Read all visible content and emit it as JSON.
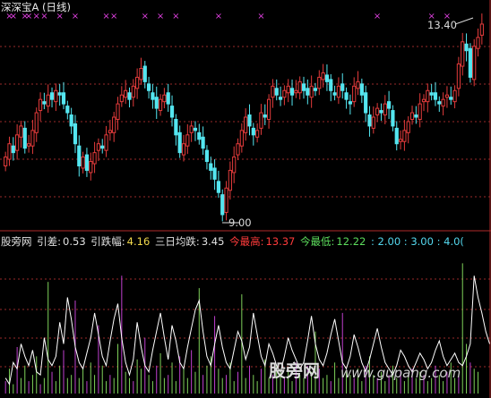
{
  "title": "深深宝A (日线)",
  "colors": {
    "up": "#e33b3b",
    "down": "#54e6f0",
    "grid": "#9a2a2a",
    "signal": "#e040e0",
    "vol_green": "#7fd15a",
    "vol_magenta": "#c040d0",
    "line_white": "#ffffff"
  },
  "indicator": {
    "name": "股旁网",
    "yincha_label": "引差:",
    "yincha_value": "0.53",
    "yindiefu_label": "引跌幅:",
    "yindiefu_value": "4.16",
    "sanri_label": "三日均跌:",
    "sanri_value": "3.45",
    "zuigao_label": "今最高:",
    "zuigao_value": "13.37",
    "zuidi_label": "今最低:",
    "zuidi_value": "12.22",
    "levels_text": ": 2.00 : 3.00 : 4.0("
  },
  "annotations": {
    "high_label": "13.40",
    "low_label": "9.00"
  },
  "watermark": {
    "cn": "股旁网",
    "url": "www.gupang.com"
  },
  "chart_data": {
    "type": "candlestick",
    "price_high": 13.4,
    "price_low": 9.0,
    "closes": [
      10.3,
      10.6,
      10.4,
      10.8,
      11.0,
      10.5,
      10.6,
      10.9,
      11.3,
      11.6,
      11.5,
      11.7,
      11.6,
      11.8,
      11.7,
      11.5,
      11.3,
      11.0,
      10.6,
      10.1,
      10.3,
      10.0,
      10.2,
      10.4,
      10.6,
      10.5,
      10.8,
      10.9,
      11.2,
      11.5,
      11.7,
      11.8,
      11.6,
      11.9,
      12.1,
      12.3,
      12.0,
      11.8,
      11.6,
      11.4,
      11.6,
      11.7,
      11.5,
      11.2,
      10.8,
      10.4,
      10.6,
      10.8,
      11.0,
      10.9,
      10.7,
      10.5,
      10.2,
      10.0,
      9.8,
      9.5,
      9.0,
      9.6,
      10.0,
      10.3,
      10.6,
      10.9,
      11.2,
      11.0,
      10.8,
      10.9,
      11.3,
      11.2,
      11.6,
      11.9,
      11.7,
      11.6,
      11.8,
      11.9,
      11.7,
      11.8,
      12.0,
      11.8,
      11.7,
      11.9,
      11.8,
      12.1,
      12.2,
      12.0,
      11.8,
      11.7,
      11.9,
      11.8,
      11.6,
      11.5,
      11.9,
      12.0,
      11.7,
      11.3,
      11.0,
      11.2,
      11.4,
      11.3,
      11.5,
      11.4,
      11.0,
      10.6,
      10.7,
      10.9,
      11.1,
      11.3,
      11.2,
      11.5,
      11.6,
      11.8,
      11.7,
      11.6,
      11.5,
      11.6,
      11.7,
      11.6,
      11.8,
      12.4,
      12.9,
      12.7,
      12.1,
      12.8,
      13.0,
      13.3
    ],
    "signal_markers": [
      1,
      2,
      5,
      6,
      8,
      10,
      14,
      18,
      26,
      28,
      36,
      40,
      44,
      55,
      66,
      96,
      110,
      114
    ],
    "oscillator": [
      0.5,
      0.3,
      1.0,
      0.8,
      1.6,
      1.2,
      0.9,
      1.4,
      0.7,
      0.6,
      1.8,
      1.1,
      0.9,
      1.2,
      2.3,
      1.6,
      3.1,
      2.4,
      1.5,
      1.0,
      0.8,
      1.3,
      1.8,
      2.6,
      1.9,
      1.2,
      0.9,
      1.7,
      2.4,
      2.9,
      1.8,
      1.0,
      0.6,
      1.1,
      2.3,
      1.5,
      0.9,
      0.7,
      1.4,
      2.0,
      2.6,
      1.8,
      1.1,
      2.2,
      1.7,
      1.0,
      0.8,
      1.5,
      2.1,
      2.7,
      3.0,
      2.0,
      1.2,
      0.9,
      1.6,
      2.2,
      1.5,
      1.0,
      0.8,
      1.4,
      2.0,
      1.7,
      1.1,
      1.5,
      2.6,
      1.9,
      1.2,
      0.9,
      1.6,
      1.3,
      0.9,
      0.7,
      1.2,
      1.8,
      1.4,
      1.1,
      0.8,
      1.0,
      1.7,
      2.5,
      1.6,
      1.1,
      0.9,
      1.3,
      1.9,
      2.4,
      1.7,
      1.0,
      0.8,
      1.2,
      1.9,
      1.5,
      1.0,
      0.7,
      1.1,
      1.6,
      2.1,
      1.5,
      1.0,
      0.8,
      0.6,
      0.9,
      1.4,
      1.2,
      0.9,
      0.7,
      1.0,
      1.3,
      1.1,
      0.8,
      1.0,
      1.4,
      1.7,
      1.2,
      0.9,
      1.1,
      1.3,
      1.0,
      0.9,
      1.2,
      1.6,
      3.8,
      3.1,
      2.6,
      2.0,
      1.6
    ],
    "volume_bars": [
      0.4,
      0.8,
      0.3,
      1.5,
      0.5,
      0.9,
      0.4,
      0.6,
      1.2,
      0.3,
      0.5,
      3.6,
      0.7,
      0.4,
      0.9,
      1.4,
      0.5,
      0.6,
      3.0,
      0.5,
      0.8,
      0.4,
      1.0,
      0.6,
      2.2,
      0.9,
      0.4,
      0.6,
      0.5,
      1.6,
      3.8,
      0.7,
      0.5,
      0.4,
      1.1,
      0.8,
      1.8,
      0.6,
      0.4,
      0.9,
      1.3,
      0.5,
      0.6,
      1.0,
      0.4,
      1.2,
      0.8,
      0.5,
      1.4,
      0.7,
      3.4,
      0.6,
      0.9,
      1.2,
      2.5,
      0.8,
      0.5,
      0.6,
      1.0,
      0.4,
      0.7,
      3.2,
      0.5,
      0.9,
      0.6,
      0.4,
      0.8,
      1.1,
      0.5,
      0.6,
      0.9,
      0.7,
      0.5,
      0.8,
      0.4,
      1.0,
      0.6,
      0.5,
      0.9,
      0.7,
      2.0,
      0.8,
      0.5,
      0.6,
      0.4,
      1.0,
      0.5,
      2.6,
      0.7,
      0.6,
      0.5,
      0.8,
      0.4,
      0.9,
      1.2,
      0.6,
      0.5,
      0.7,
      0.4,
      0.6,
      0.9,
      0.5,
      0.7,
      0.4,
      0.6,
      0.8,
      0.5,
      0.7,
      0.6,
      0.4,
      0.5,
      0.9,
      0.6,
      0.4,
      0.7,
      1.0,
      0.5,
      0.6,
      4.2,
      1.6,
      1.0,
      0.8,
      0.7
    ]
  }
}
